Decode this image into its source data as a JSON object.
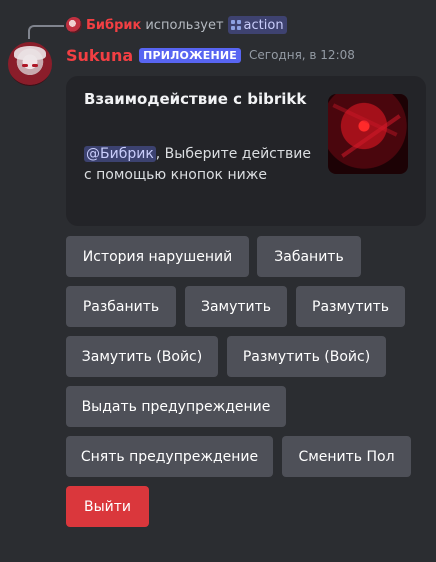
{
  "reply": {
    "user": "Бибрик",
    "verb": "использует",
    "command": "action"
  },
  "message": {
    "author": "Sukuna",
    "badge": "ПРИЛОЖЕНИЕ",
    "timestamp": "Сегодня, в 12:08"
  },
  "embed": {
    "title": "Взаимодействие с bibrikk",
    "mention": "@Бибрик",
    "description": ", Выберите действие с помощью кнопок ниже"
  },
  "buttons": {
    "history": "История нарушений",
    "ban": "Забанить",
    "unban": "Разбанить",
    "mute": "Замутить",
    "unmute": "Размутить",
    "mute_voice": "Замутить (Войс)",
    "unmute_voice": "Размутить (Войс)",
    "warn": "Выдать предупреждение",
    "unwarn": "Снять предупреждение",
    "change_gender": "Сменить Пол",
    "exit": "Выйти"
  },
  "colors": {
    "background": "#2b2d31",
    "embed": "#232428",
    "author": "#f23f43",
    "badge": "#5865f2",
    "button": "#4e5058",
    "danger": "#da373c"
  }
}
